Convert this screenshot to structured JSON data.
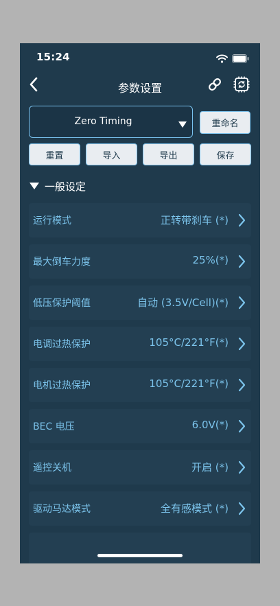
{
  "status": {
    "time": "15:24"
  },
  "nav": {
    "title": "参数设置"
  },
  "profile": {
    "selected": "Zero Timing"
  },
  "buttons": {
    "rename": "重命名",
    "reset": "重置",
    "import": "导入",
    "export": "导出",
    "save": "保存"
  },
  "section": {
    "title": "一般设定"
  },
  "settings": [
    {
      "label": "运行模式",
      "value": "正转带刹车 (*)"
    },
    {
      "label": "最大倒车力度",
      "value": "25%(*)"
    },
    {
      "label": "低压保护阈值",
      "value": "自动 (3.5V/Cell)(*)"
    },
    {
      "label": "电调过热保护",
      "value": "105°C/221°F(*)"
    },
    {
      "label": "电机过热保护",
      "value": "105°C/221°F(*)"
    },
    {
      "label": "BEC 电压",
      "value": "6.0V(*)"
    },
    {
      "label": "遥控关机",
      "value": "开启 (*)"
    },
    {
      "label": "驱动马达模式",
      "value": "全有感模式 (*)"
    }
  ],
  "colors": {
    "background": "#1f3a4c",
    "accent": "#7cc4ec",
    "row": "#233f52"
  }
}
